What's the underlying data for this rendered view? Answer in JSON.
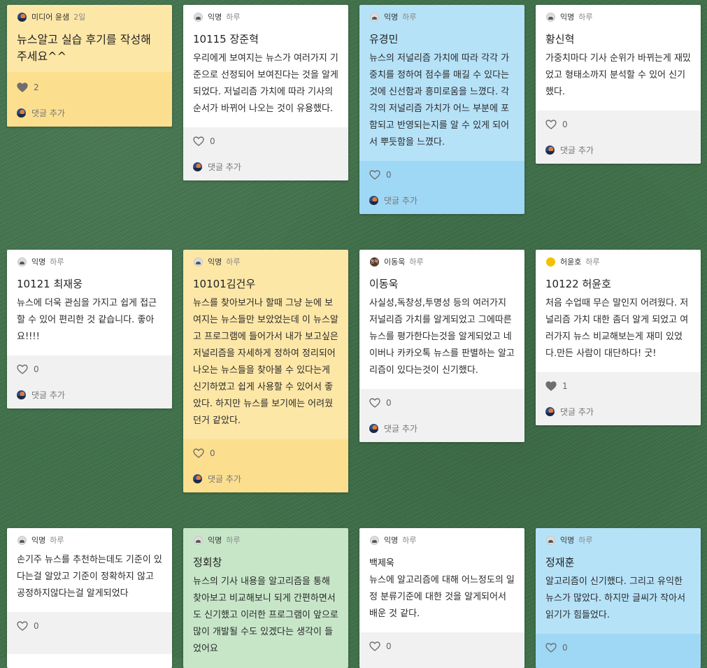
{
  "ui": {
    "comment_add_label": "댓글 추가",
    "like_icon": "heart-icon",
    "avatar_icon": "avatar-icon"
  },
  "colors": {
    "board_background": "#3f7049",
    "yellow": "#fde7a7",
    "white": "#ffffff",
    "blue": "#b6e2f8",
    "green": "#c7e6c8"
  },
  "posts": [
    {
      "author": "미디어 윤샘",
      "time_ago": "2일",
      "title": "",
      "text": "뉴스알고 실습 후기를 작성해 주세요^^",
      "likes": "2",
      "liked": true,
      "color": "yellow",
      "avatar": "img"
    },
    {
      "author": "익명",
      "time_ago": "하루",
      "title": "10115 장준혁",
      "text": "우리에게 보여지는 뉴스가 여러가지 기준으로 선정되어 보여진다는 것을 알게되었다. 저널리즘 가치에 따라 기사의 순서가 바뀌어 나오는 것이 유용했다.",
      "likes": "0",
      "liked": false,
      "color": "white",
      "avatar": "anon"
    },
    {
      "author": "익명",
      "time_ago": "하루",
      "title": "유경민",
      "text": "뉴스의 저널리즘 가치에 따라 각각 가중치를 정하여 점수를 매길 수 있다는 것에 신선함과 흥미로움을 느꼈다. 각각의 저널리즘 가치가 어느 부분에 포함되고 반영되는지를 알 수 있게 되어서 뿌듯함을 느꼈다.",
      "likes": "0",
      "liked": false,
      "color": "blue",
      "avatar": "anon"
    },
    {
      "author": "익명",
      "time_ago": "하루",
      "title": "황신혁",
      "text": "가중치마다 기사 순위가 바뀌는게 재밌었고 형태소까지 분석할 수 있어 신기했다.",
      "likes": "0",
      "liked": false,
      "color": "white",
      "avatar": "anon"
    },
    {
      "author": "익명",
      "time_ago": "하루",
      "title": "10121 최재웅",
      "text": "뉴스에 더욱 관심을 가지고 쉽게 접근 할 수 있어 편리한 것 같습니다. 좋아요!!!!",
      "likes": "0",
      "liked": false,
      "color": "white",
      "avatar": "anon"
    },
    {
      "author": "익명",
      "time_ago": "하루",
      "title": "10101김건우",
      "text": "뉴스를 찾아보거나 할때 그냥 눈에 보여지는 뉴스들만 보았었는데 이 뉴스알고 프로그램에 들어가서 내가 보고싶은 저널리즘을 자세하게 정하여 정리되어 나오는 뉴스들을 찾아볼 수 있다는게 신기하였고 쉽게 사용할 수 있어서 좋았다. 하지만 뉴스를 보기에는 어려웠던거 같았다.",
      "likes": "0",
      "liked": false,
      "color": "yellow",
      "avatar": "anon"
    },
    {
      "author": "이동욱",
      "time_ago": "하루",
      "title": "이동욱",
      "text": "사실성,독창성,투명성 등의 여러가지 저널리즘 가치를 알게되었고 그에따른 뉴스를 평가한다는것을 알게되었고 네이버나 카카오톡 뉴스를 판별하는 알고리즘이 있다는것이 신기했다.",
      "likes": "0",
      "liked": false,
      "color": "white",
      "avatar": "letters",
      "avatar_text": "동욱"
    },
    {
      "author": "허윤호",
      "time_ago": "하루",
      "title": "10122 허윤호",
      "text": "처음 수업때 무슨 말인지 어려웠다. 저널리즘 가치 대한 좀더 알게 되었고 여러가지 뉴스 비교해보는게 재미 있었다.만든 사람이 대단하다! 굿!",
      "likes": "1",
      "liked": true,
      "color": "white",
      "avatar": "yellow"
    },
    {
      "author": "익명",
      "time_ago": "하루",
      "title": "",
      "text": "손기주 뉴스를 추천하는데도 기준이 있다는걸 알았고 기준이 정확하지 않고 공정하지않다는걸 알게되었다",
      "likes": "0",
      "liked": false,
      "color": "white",
      "avatar": "anon"
    },
    {
      "author": "익명",
      "time_ago": "하루",
      "title": "정회창",
      "text": "뉴스의 기사 내용을 알고리즘을 통해 찾아보고 비교해보니 되게 간편하면서도 신기했고 이러한 프로그램이 앞으로 많이 개발될 수도 있겠다는 생각이 들었어요",
      "likes": "",
      "liked": false,
      "color": "green",
      "avatar": "anon"
    },
    {
      "author": "익명",
      "time_ago": "하루",
      "title": "백제욱",
      "text": "뉴스에 알고리즘에 대해 어느정도의 일정 분류기준에 대한 것을 알게되어서 배운 것 같다.",
      "likes": "0",
      "liked": false,
      "color": "white",
      "avatar": "anon"
    },
    {
      "author": "익명",
      "time_ago": "하루",
      "title": "정재훈",
      "text": "알고리즘이 신기했다. 그리고 유익한 뉴스가 많았다. 하지만 글씨가 작아서 읽기가 힘들었다.",
      "likes": "0",
      "liked": false,
      "color": "blue",
      "avatar": "anon"
    }
  ]
}
